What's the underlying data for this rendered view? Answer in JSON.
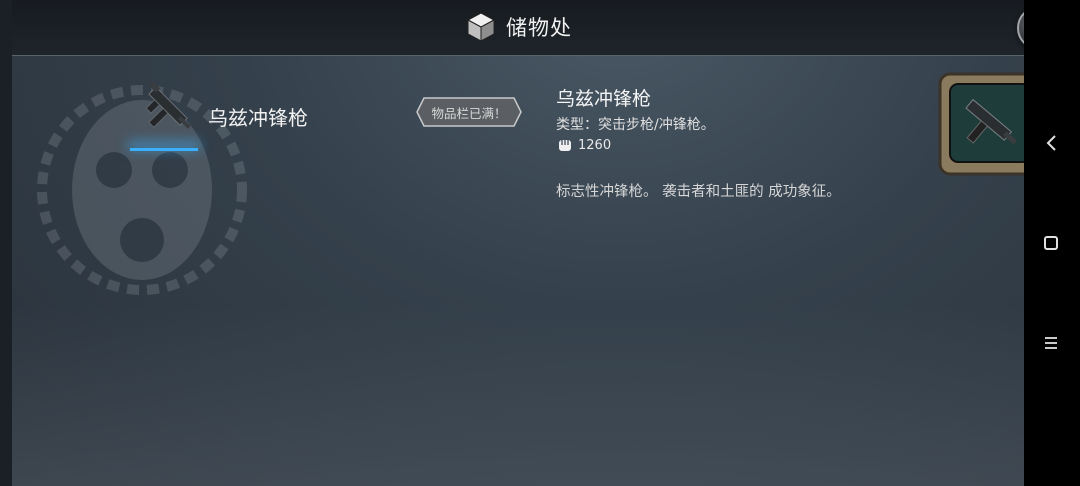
{
  "header": {
    "title": "储物处",
    "title_icon": "cube-icon",
    "close_icon": "close-icon"
  },
  "item_list": [
    {
      "name": "乌兹冲锋枪",
      "icon": "uzi-smg-icon",
      "selected": true
    }
  ],
  "badge": {
    "text": "物品栏已满！"
  },
  "detail": {
    "name": "乌兹冲锋枪",
    "type_line": "类型：突击步枪/冲锋枪。",
    "power_icon": "fist-icon",
    "power_value": "1260",
    "description": "标志性冲锋枪。 袭击者和土匪的 成功象征。"
  },
  "preview": {
    "icon": "uzi-smg-icon"
  },
  "system_nav": {
    "back_icon": "back-icon",
    "home_icon": "home-icon",
    "menu_icon": "menu-icon"
  },
  "colors": {
    "accent": "#3ab0ff",
    "panel": "#34404b",
    "text": "#f2f2f2"
  }
}
